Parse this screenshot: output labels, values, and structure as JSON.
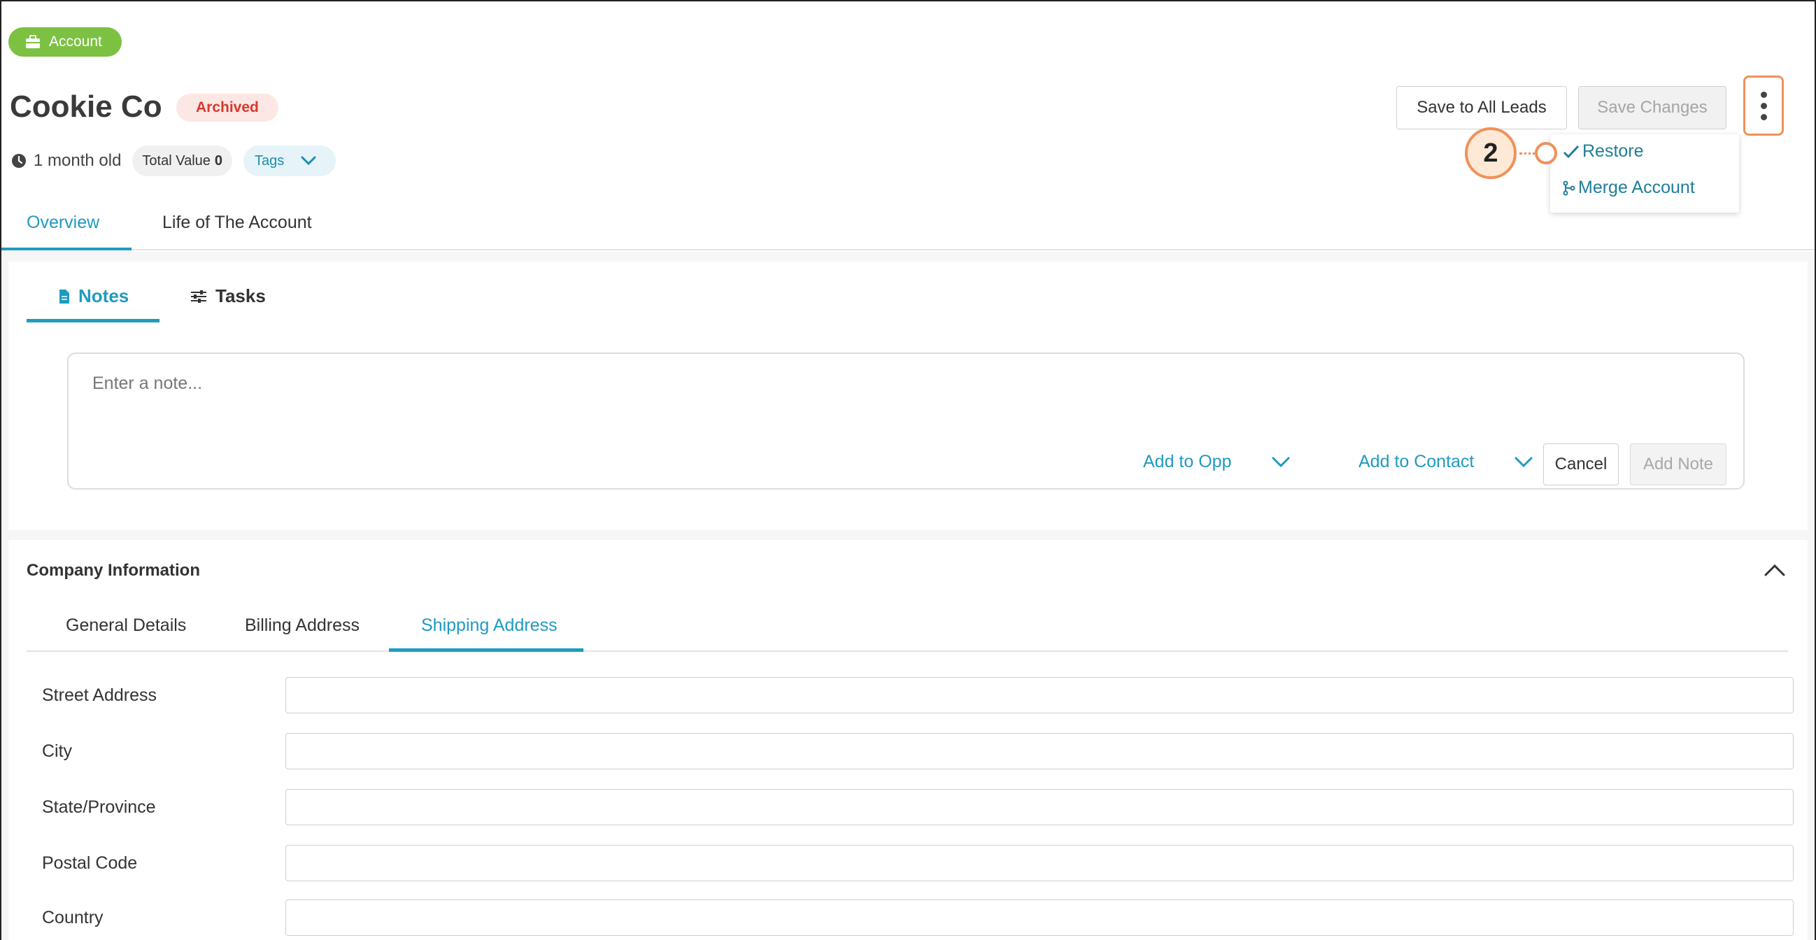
{
  "header": {
    "type_badge": "Account",
    "title": "Cookie Co",
    "status_badge": "Archived",
    "age": "1 month old",
    "total_value_label": "Total Value",
    "total_value": "0",
    "tags_label": "Tags",
    "save_all_label": "Save to All Leads",
    "save_changes_label": "Save Changes"
  },
  "more_menu": {
    "items": [
      {
        "label": "Restore",
        "icon": "checkmark-icon"
      },
      {
        "label": "Merge Account",
        "icon": "merge-icon"
      }
    ]
  },
  "annotation": {
    "step": "2"
  },
  "main_tabs": [
    {
      "label": "Overview",
      "active": true
    },
    {
      "label": "Life of The Account",
      "active": false
    }
  ],
  "notes_panel": {
    "tabs": [
      {
        "label": "Notes",
        "icon": "document-icon",
        "active": true
      },
      {
        "label": "Tasks",
        "icon": "sliders-icon",
        "active": false
      }
    ],
    "placeholder": "Enter a note...",
    "add_to_opp": "Add to Opp",
    "add_to_contact": "Add to Contact",
    "cancel_label": "Cancel",
    "add_note_label": "Add Note"
  },
  "company_info": {
    "title": "Company Information",
    "tabs": [
      {
        "label": "General Details",
        "active": false
      },
      {
        "label": "Billing Address",
        "active": false
      },
      {
        "label": "Shipping Address",
        "active": true
      }
    ],
    "fields": [
      {
        "label": "Street Address",
        "value": ""
      },
      {
        "label": "City",
        "value": ""
      },
      {
        "label": "State/Province",
        "value": ""
      },
      {
        "label": "Postal Code",
        "value": ""
      },
      {
        "label": "Country",
        "value": ""
      }
    ]
  },
  "colors": {
    "accent": "#1f9bbf",
    "account_badge": "#7cc142",
    "archived_text": "#d6392c",
    "annotation": "#f0915a"
  }
}
